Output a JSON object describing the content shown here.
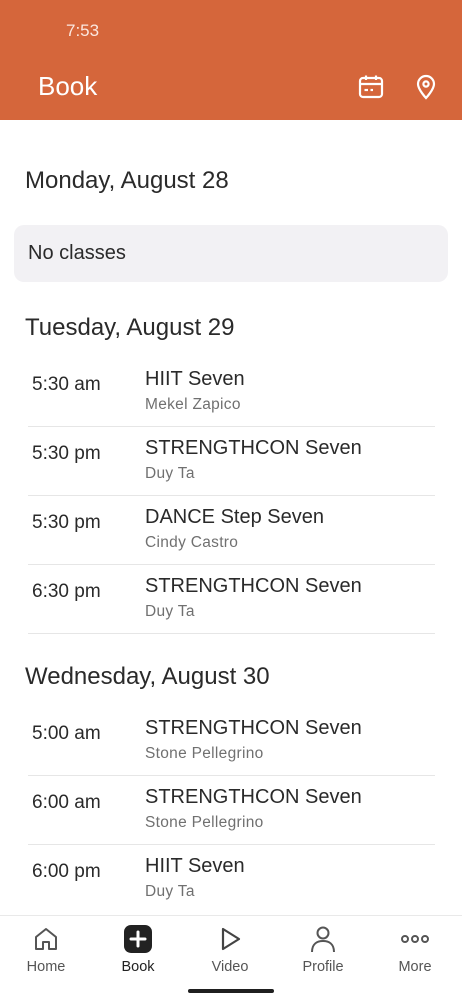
{
  "status_bar": {
    "time": "7:53"
  },
  "header": {
    "title": "Book",
    "icons": [
      "calendar-icon",
      "location-pin-icon"
    ]
  },
  "colors": {
    "header_bg": "#d5663b",
    "empty_day_bg": "#f2f1f4"
  },
  "days": [
    {
      "heading": "Monday, August 28",
      "empty_message": "No classes",
      "classes": []
    },
    {
      "heading": "Tuesday, August 29",
      "classes": [
        {
          "time": "5:30 am",
          "name": "HIIT Seven",
          "instructor": "Mekel Zapico"
        },
        {
          "time": "5:30 pm",
          "name": "STRENGTHCON Seven",
          "instructor": "Duy Ta"
        },
        {
          "time": "5:30 pm",
          "name": "DANCE Step Seven",
          "instructor": "Cindy Castro"
        },
        {
          "time": "6:30 pm",
          "name": "STRENGTHCON Seven",
          "instructor": "Duy Ta"
        }
      ]
    },
    {
      "heading": "Wednesday, August 30",
      "classes": [
        {
          "time": "5:00 am",
          "name": "STRENGTHCON Seven",
          "instructor": "Stone Pellegrino"
        },
        {
          "time": "6:00 am",
          "name": "STRENGTHCON Seven",
          "instructor": "Stone Pellegrino"
        },
        {
          "time": "6:00 pm",
          "name": "HIIT Seven",
          "instructor": "Duy Ta"
        }
      ]
    }
  ],
  "bottom_nav": {
    "active": "Book",
    "items": [
      {
        "label": "Home",
        "icon": "home-icon"
      },
      {
        "label": "Book",
        "icon": "plus-square-icon"
      },
      {
        "label": "Video",
        "icon": "play-icon"
      },
      {
        "label": "Profile",
        "icon": "person-icon"
      },
      {
        "label": "More",
        "icon": "more-dots-icon"
      }
    ]
  }
}
